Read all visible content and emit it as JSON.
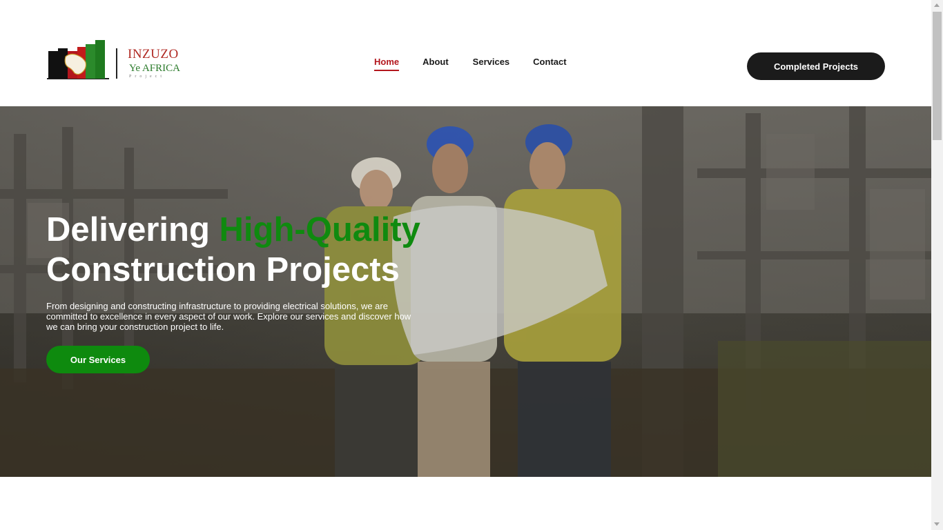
{
  "brand": {
    "line1": "INZUZO",
    "line2_a": "Ye",
    "line2_b": "AFRICA",
    "line3": "Project",
    "colors": {
      "red": "#b02a23",
      "green": "#2a7a2a"
    }
  },
  "nav": {
    "items": [
      {
        "label": "Home",
        "active": true
      },
      {
        "label": "About"
      },
      {
        "label": "Services"
      },
      {
        "label": "Contact"
      }
    ],
    "active_color": "#b3161d"
  },
  "header_cta": {
    "label": "Completed Projects"
  },
  "hero": {
    "title_part1": "Delivering",
    "title_highlight": "High-Quality",
    "title_line2": "Construction Projects",
    "description": "From designing and constructing infrastructure to providing electrical solutions, we are committed to excellence in every aspect of our work. Explore our services and discover how we can bring your construction project to life.",
    "cta": "Our Services",
    "accent_color": "#0e8a0e"
  }
}
